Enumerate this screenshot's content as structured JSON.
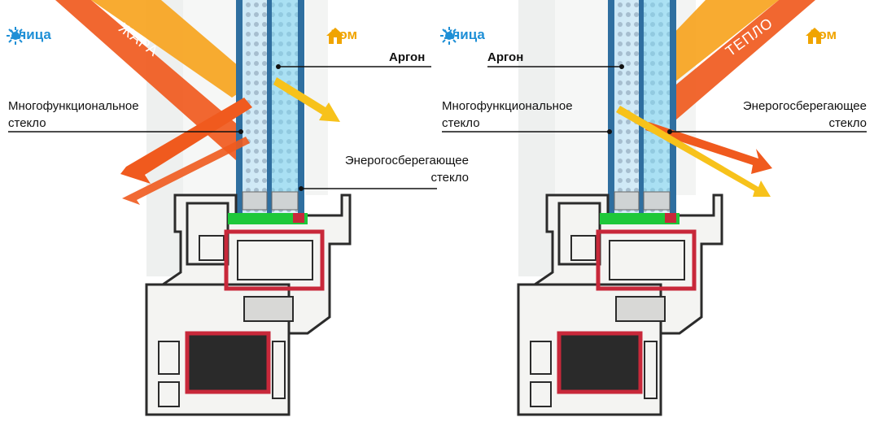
{
  "colors": {
    "street": "#1e8fd6",
    "home": "#f0a400",
    "heat_ray": "#f05a1e",
    "warm_ray": "#f7c21b",
    "frame_pvc": "#f4f4f2",
    "steel_core": "#c8283a",
    "seal_green": "#1ec83a"
  },
  "panels": [
    {
      "street_label": "Улица",
      "home_label": "Дом",
      "ray_label": "ЖАРА",
      "labels": {
        "argon": "Аргон",
        "multifunctional": [
          "Многофункциональное",
          "стекло"
        ],
        "energy": [
          "Энерогосберегающее",
          "стекло"
        ]
      }
    },
    {
      "street_label": "Улица",
      "home_label": "Дом",
      "ray_label": "ТЕПЛО",
      "labels": {
        "argon": "Аргон",
        "multifunctional": [
          "Многофункциональное",
          "стекло"
        ],
        "energy": [
          "Энерогосберегающее",
          "стекло"
        ]
      }
    }
  ],
  "icons": {
    "street": "sun-icon",
    "home": "house-icon"
  }
}
